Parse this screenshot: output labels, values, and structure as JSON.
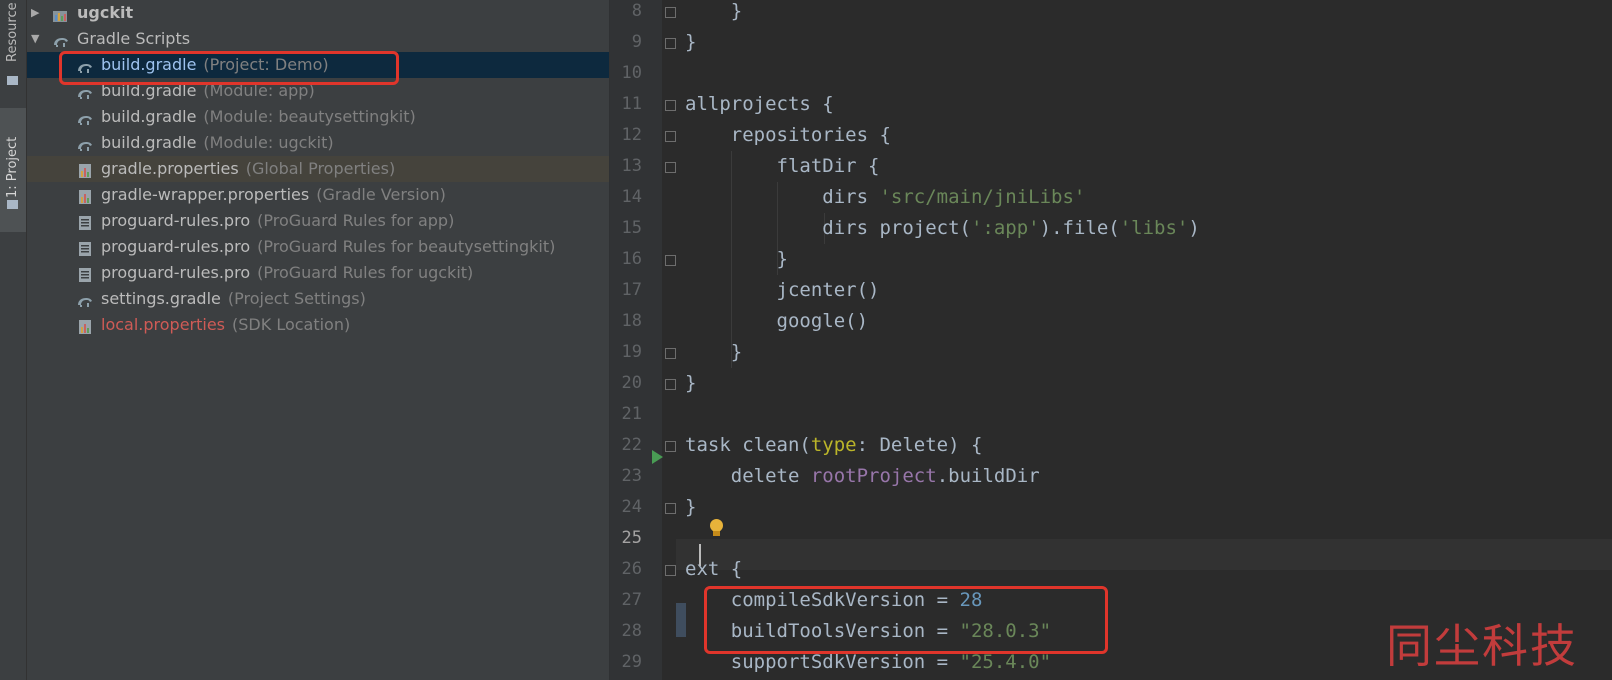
{
  "tool_window_tabs": {
    "resource_manager": "Resource",
    "project": "1: Project"
  },
  "tree": {
    "rows": [
      {
        "name": "ugckit",
        "desc": "",
        "kind": "module-folder",
        "bold": true,
        "arrow": "▶"
      },
      {
        "name": "Gradle Scripts",
        "desc": "",
        "kind": "gradle-folder",
        "arrow": "▼"
      },
      {
        "name": "build.gradle",
        "desc": "(Project: Demo)",
        "kind": "gradle-file",
        "selected": true
      },
      {
        "name": "build.gradle",
        "desc": "(Module: app)",
        "kind": "gradle-file"
      },
      {
        "name": "build.gradle",
        "desc": "(Module: beautysettingkit)",
        "kind": "gradle-file"
      },
      {
        "name": "build.gradle",
        "desc": "(Module: ugckit)",
        "kind": "gradle-file"
      },
      {
        "name": "gradle.properties",
        "desc": "(Global Properties)",
        "kind": "properties-file",
        "hover": true
      },
      {
        "name": "gradle-wrapper.properties",
        "desc": "(Gradle Version)",
        "kind": "properties-file"
      },
      {
        "name": "proguard-rules.pro",
        "desc": "(ProGuard Rules for app)",
        "kind": "text-file"
      },
      {
        "name": "proguard-rules.pro",
        "desc": "(ProGuard Rules for beautysettingkit)",
        "kind": "text-file"
      },
      {
        "name": "proguard-rules.pro",
        "desc": "(ProGuard Rules for ugckit)",
        "kind": "text-file"
      },
      {
        "name": "settings.gradle",
        "desc": "(Project Settings)",
        "kind": "gradle-file"
      },
      {
        "name": "local.properties",
        "desc": "(SDK Location)",
        "kind": "properties-file",
        "red": true
      }
    ]
  },
  "editor": {
    "current_line": "25",
    "lines": [
      {
        "n": "8",
        "t": "    }"
      },
      {
        "n": "9",
        "t": "}"
      },
      {
        "n": "10",
        "t": ""
      },
      {
        "n": "11",
        "t": "allprojects {"
      },
      {
        "n": "12",
        "t": "    repositories {"
      },
      {
        "n": "13",
        "t": "        flatDir {"
      },
      {
        "n": "14",
        "t": "            dirs 'src/main/jniLibs'"
      },
      {
        "n": "15",
        "t": "            dirs project(':app').file('libs')"
      },
      {
        "n": "16",
        "t": "        }"
      },
      {
        "n": "17",
        "t": "        jcenter()"
      },
      {
        "n": "18",
        "t": "        google()"
      },
      {
        "n": "19",
        "t": "    }"
      },
      {
        "n": "20",
        "t": "}"
      },
      {
        "n": "21",
        "t": ""
      },
      {
        "n": "22",
        "t": "task clean(type: Delete) {"
      },
      {
        "n": "23",
        "t": "    delete rootProject.buildDir"
      },
      {
        "n": "24",
        "t": "}"
      },
      {
        "n": "25",
        "t": ""
      },
      {
        "n": "26",
        "t": "ext {"
      },
      {
        "n": "27",
        "t": "    compileSdkVersion = 28"
      },
      {
        "n": "28",
        "t": "    buildToolsVersion = \"28.0.3\""
      },
      {
        "n": "29",
        "t": "    supportSdkVersion = \"25.4.0\""
      }
    ]
  },
  "watermark": "同尘科技",
  "colors": {
    "highlight_box": "#e0352b",
    "string": "#6a8759",
    "number": "#6897bb",
    "field": "#9876aa",
    "param": "#bbb529",
    "selected_row": "#0d293e"
  }
}
